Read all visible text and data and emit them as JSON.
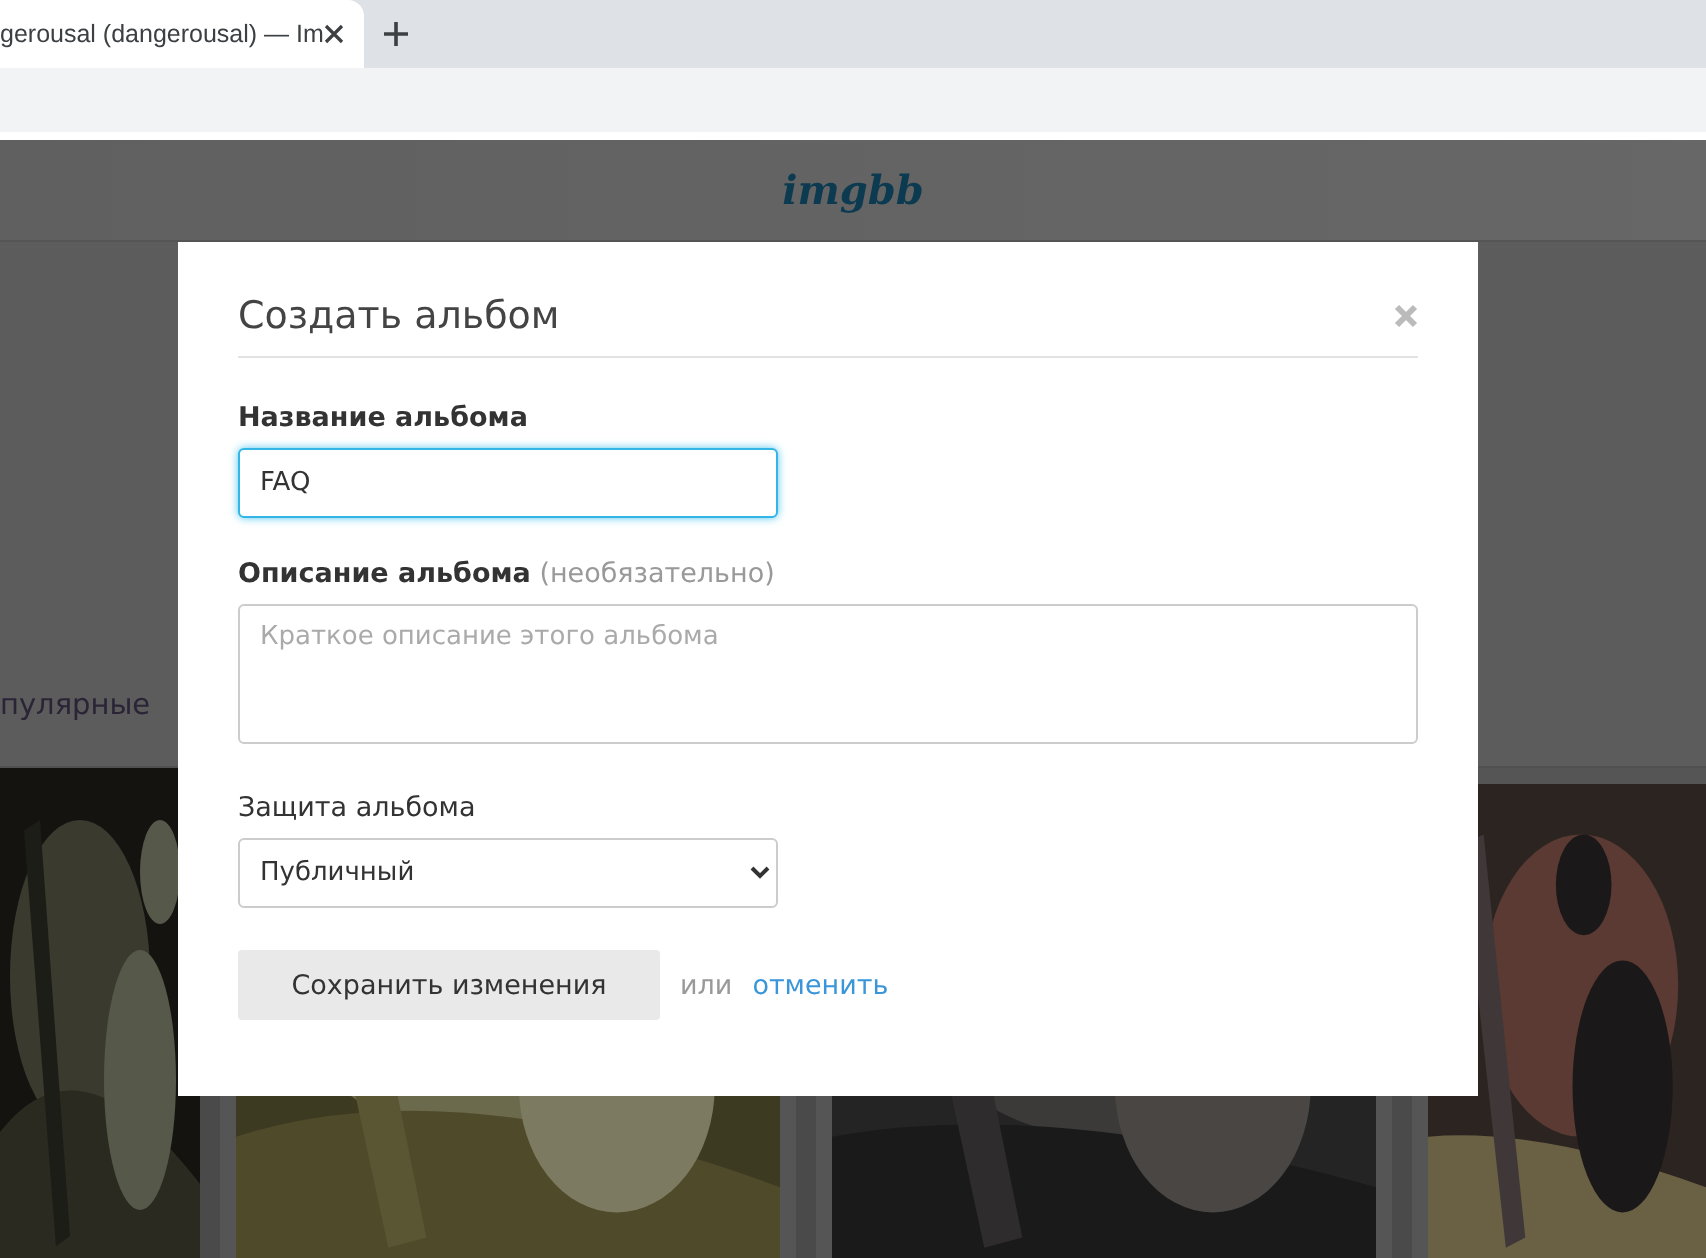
{
  "browser": {
    "tab": {
      "title": "gerousal (dangerousal) — Im"
    }
  },
  "site": {
    "logo": "imgbb",
    "nav_label": "пулярные"
  },
  "modal": {
    "title": "Создать альбом",
    "fields": [
      {
        "kind": "text",
        "label": "Название альбома",
        "value": "FAQ",
        "focused": true
      },
      {
        "kind": "textarea",
        "label": "Описание альбома",
        "hint": "(необязательно)",
        "placeholder": "Краткое описание этого альбома",
        "focused": false
      },
      {
        "kind": "select",
        "label": "Защита альбома",
        "value": "Публичный",
        "focused": false
      }
    ],
    "submit": "Сохранить изменения",
    "or": "или",
    "cancel": "отменить"
  }
}
